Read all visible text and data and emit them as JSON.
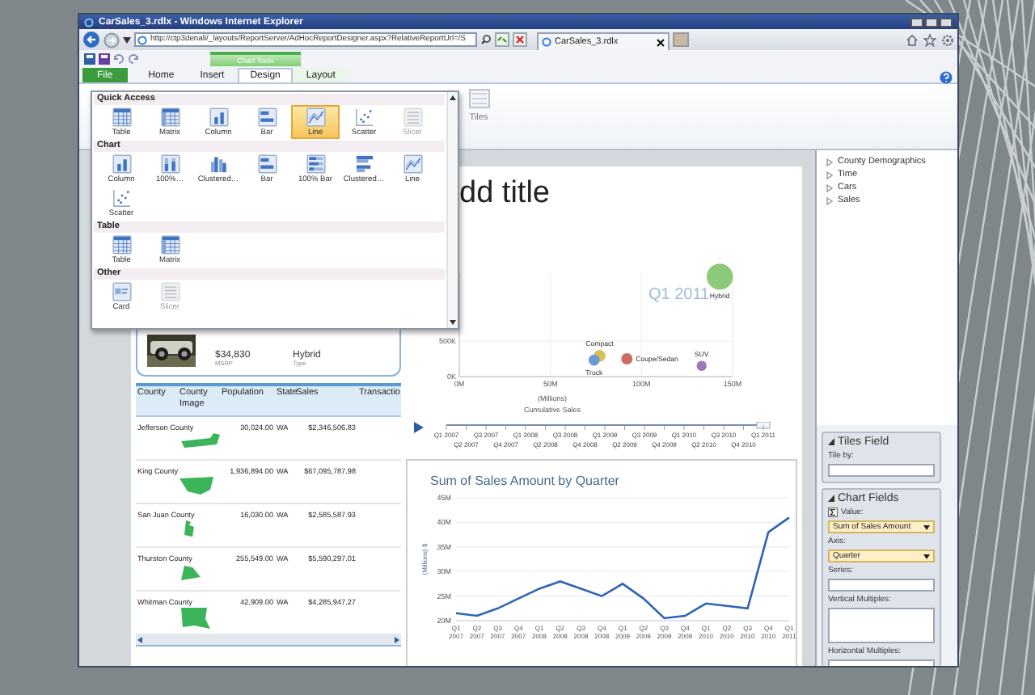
{
  "window": {
    "title": "CarSales_3.rdlx - Windows Internet Explorer"
  },
  "address_bar": {
    "url": "http://ctp3denali/_layouts/ReportServer/AdHocReportDesigner.aspx?RelativeReportUrl=/S"
  },
  "browser_tabs": [
    {
      "label": "CarSales_3.rdlx",
      "selected": true
    }
  ],
  "ribbon": {
    "contextual_group": "Chart Tools",
    "tabs": [
      {
        "label": "File",
        "kind": "file",
        "selected": false
      },
      {
        "label": "Home",
        "kind": "tab",
        "selected": false
      },
      {
        "label": "Insert",
        "kind": "tab",
        "selected": false
      },
      {
        "label": "Design",
        "kind": "contextual",
        "selected": true
      },
      {
        "label": "Layout",
        "kind": "contextual",
        "selected": false
      }
    ],
    "buttons": [
      {
        "label": "Tiles"
      }
    ]
  },
  "gallery": {
    "sections": [
      {
        "title": "Quick Access",
        "items": [
          {
            "label": "Table",
            "kind": "table",
            "selected": false,
            "disabled": false
          },
          {
            "label": "Matrix",
            "kind": "matrix",
            "selected": false,
            "disabled": false
          },
          {
            "label": "Column",
            "kind": "column",
            "selected": false,
            "disabled": false
          },
          {
            "label": "Bar",
            "kind": "bar",
            "selected": false,
            "disabled": false
          },
          {
            "label": "Line",
            "kind": "line",
            "selected": true,
            "disabled": false
          },
          {
            "label": "Scatter",
            "kind": "scatter",
            "selected": false,
            "disabled": false
          },
          {
            "label": "Slicer",
            "kind": "slicer",
            "selected": false,
            "disabled": true
          }
        ]
      },
      {
        "title": "Chart",
        "items": [
          {
            "label": "Column",
            "kind": "column",
            "selected": false,
            "disabled": false
          },
          {
            "label": "100%…",
            "kind": "stacked-column",
            "selected": false,
            "disabled": false
          },
          {
            "label": "Clustered…",
            "kind": "clustered-column",
            "selected": false,
            "disabled": false
          },
          {
            "label": "Bar",
            "kind": "bar",
            "selected": false,
            "disabled": false
          },
          {
            "label": "100% Bar",
            "kind": "stacked-bar",
            "selected": false,
            "disabled": false
          },
          {
            "label": "Clustered…",
            "kind": "clustered-bar",
            "selected": false,
            "disabled": false
          },
          {
            "label": "Line",
            "kind": "line",
            "selected": false,
            "disabled": false
          },
          {
            "label": "Scatter",
            "kind": "scatter",
            "selected": false,
            "disabled": false
          }
        ]
      },
      {
        "title": "Table",
        "items": [
          {
            "label": "Table",
            "kind": "table",
            "selected": false,
            "disabled": false
          },
          {
            "label": "Matrix",
            "kind": "matrix",
            "selected": false,
            "disabled": false
          }
        ]
      },
      {
        "title": "Other",
        "items": [
          {
            "label": "Card",
            "kind": "card",
            "selected": false,
            "disabled": false
          },
          {
            "label": "Slicer",
            "kind": "slicer",
            "selected": false,
            "disabled": true
          }
        ]
      }
    ]
  },
  "report": {
    "title": "dd title",
    "card": {
      "fields": [
        {
          "value": "$34,830",
          "label": "MSRP"
        },
        {
          "value": "Hybrid",
          "label": "Type"
        }
      ]
    },
    "table": {
      "columns": [
        "County",
        "County Image",
        "Population",
        "State",
        "Sales",
        "Transactio"
      ],
      "rows": [
        {
          "county": "Jefferson County",
          "population": "30,024.00",
          "state": "WA",
          "sales": "$2,346,506.83"
        },
        {
          "county": "King County",
          "population": "1,936,894.00",
          "state": "WA",
          "sales": "$67,095,787.98"
        },
        {
          "county": "San Juan County",
          "population": "16,030.00",
          "state": "WA",
          "sales": "$2,585,587.93"
        },
        {
          "county": "Thurston County",
          "population": "255,549.00",
          "state": "WA",
          "sales": "$5,590,297.01"
        },
        {
          "county": "Whitman County",
          "population": "42,909.00",
          "state": "WA",
          "sales": "$4,285,947.27"
        }
      ]
    },
    "scatter": {
      "chart_data": {
        "type": "scatter",
        "xlabel": "(Millions)\nCumulative Sales",
        "xlim": [
          0,
          150
        ],
        "ylim": [
          0,
          1450
        ],
        "x": [
          143,
          77,
          74,
          92,
          133
        ],
        "xticks": [
          {
            "value": 0,
            "label": "0M"
          },
          {
            "value": 50,
            "label": "50M"
          },
          {
            "value": 100,
            "label": "100M"
          },
          {
            "value": 150,
            "label": "150M"
          }
        ],
        "yticks": [
          {
            "value": 0,
            "label": "0K"
          },
          {
            "value": 500,
            "label": "500K"
          }
        ],
        "grid": true,
        "annotations": [
          {
            "text": "Q1 2011"
          }
        ],
        "series": [
          {
            "name": "Hybrid",
            "color": "#8cc97a",
            "values": [
              1400,
              null,
              null,
              null,
              null
            ]
          },
          {
            "name": "Compact",
            "color": "#d9bf55",
            "values": [
              null,
              290,
              null,
              null,
              null
            ]
          },
          {
            "name": "Truck",
            "color": "#6b9bd6",
            "values": [
              null,
              null,
              230,
              null,
              null
            ]
          },
          {
            "name": "Coupe/Sedan",
            "color": "#d06b63",
            "values": [
              null,
              null,
              null,
              250,
              null
            ]
          },
          {
            "name": "SUV",
            "color": "#9b7ab8",
            "values": [
              null,
              null,
              null,
              null,
              150
            ]
          }
        ]
      }
    },
    "play_axis": {
      "level": 1,
      "labels": [
        "Q1 2007",
        "Q2 2007",
        "Q3 2007",
        "Q4 2007",
        "Q1 2008",
        "Q2 2008",
        "Q3 2008",
        "Q4 2008",
        "Q1 2009",
        "Q2 2009",
        "Q3 2009",
        "Q4 2009",
        "Q1 2010",
        "Q2 2010",
        "Q3 2010",
        "Q4 2010",
        "Q1 2011"
      ]
    },
    "line_chart": {
      "chart_data": {
        "type": "line",
        "title": "Sum of Sales Amount by Quarter",
        "ylabel": "(Millions) $",
        "ylim": [
          20,
          45
        ],
        "grid": true,
        "yticks": [
          {
            "value": 20,
            "label": "20M"
          },
          {
            "value": 25,
            "label": "25M"
          },
          {
            "value": 30,
            "label": "30M"
          },
          {
            "value": 35,
            "label": "35M"
          },
          {
            "value": 40,
            "label": "40M"
          },
          {
            "value": 45,
            "label": "45M"
          }
        ],
        "categories": [
          "Q1 2007",
          "Q2 2007",
          "Q3 2007",
          "Q4 2007",
          "Q1 2008",
          "Q2 2008",
          "Q3 2008",
          "Q4 2008",
          "Q1 2009",
          "Q2 2009",
          "Q3 2009",
          "Q4 2009",
          "Q1 2010",
          "Q2 2010",
          "Q3 2010",
          "Q4 2010",
          "Q1 2011"
        ],
        "series": [
          {
            "color": "#2f63b6",
            "values": [
              21.5,
              21,
              22.5,
              24.5,
              26.5,
              28,
              26.5,
              25,
              27.5,
              24.5,
              20.5,
              21,
              23.5,
              23,
              22.5,
              38,
              41
            ]
          }
        ]
      }
    }
  },
  "field_list": {
    "items": [
      {
        "label": "County Demographics",
        "expanded": false
      },
      {
        "label": "Time",
        "expanded": false
      },
      {
        "label": "Cars",
        "expanded": false
      },
      {
        "label": "Sales",
        "expanded": false
      }
    ]
  },
  "layout_pane": {
    "sections": [
      {
        "title": "Tiles Field",
        "expanded": true,
        "fields": [
          {
            "label": "Tile by:",
            "kind": "box"
          }
        ]
      },
      {
        "title": "Chart Fields",
        "expanded": true,
        "fields": [
          {
            "label": "Value:",
            "kind": "measure",
            "value": "Sum of Sales Amount"
          },
          {
            "label": "Axis:",
            "kind": "dropdown",
            "value": "Quarter"
          },
          {
            "label": "Series:",
            "kind": "box"
          },
          {
            "label": "Vertical Multiples:",
            "kind": "area"
          },
          {
            "label": "Horizontal Multiples:",
            "kind": "box"
          }
        ]
      }
    ]
  }
}
